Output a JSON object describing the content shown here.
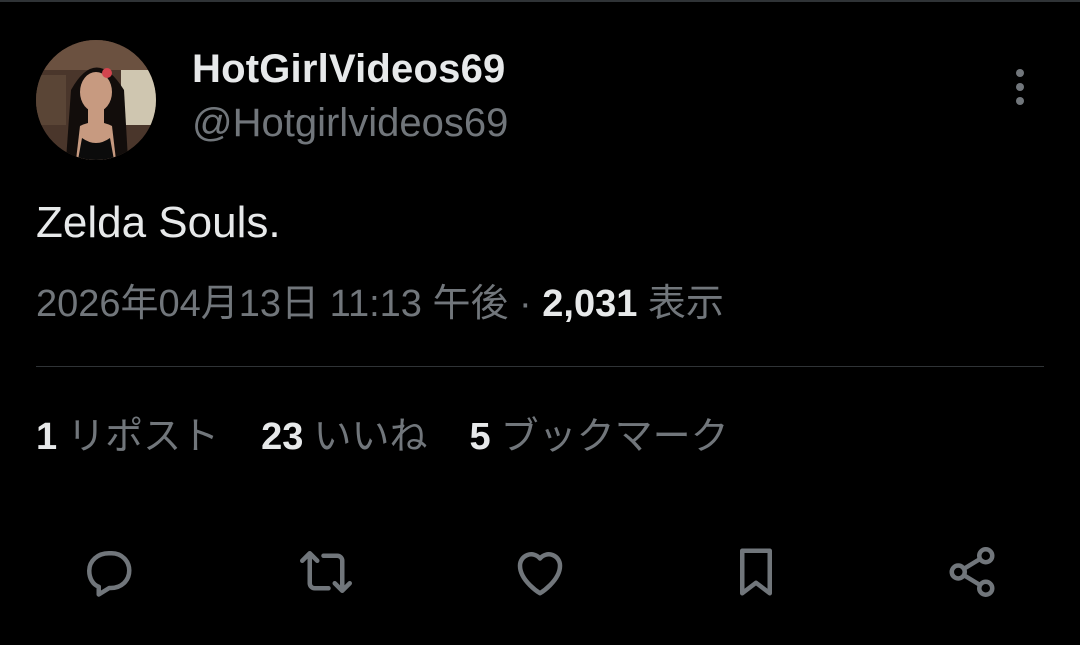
{
  "author": {
    "display_name": "HotGirlVideos69",
    "handle": "@Hotgirlvideos69"
  },
  "tweet": {
    "text": "Zelda Souls.",
    "timestamp": "2026年04月13日 11:13 午後",
    "separator": "·",
    "view_count": "2,031",
    "views_label": "表示"
  },
  "stats": {
    "reposts": {
      "count": "1",
      "label": "リポスト"
    },
    "likes": {
      "count": "23",
      "label": "いいね"
    },
    "bookmarks": {
      "count": "5",
      "label": "ブックマーク"
    }
  },
  "actions": [
    "reply-icon",
    "retweet-icon",
    "heart-icon",
    "bookmark-icon",
    "share-icon"
  ],
  "colors": {
    "background": "#000000",
    "primary_text": "#e7e9ea",
    "secondary_text": "#71767b",
    "divider": "#2f3336"
  }
}
